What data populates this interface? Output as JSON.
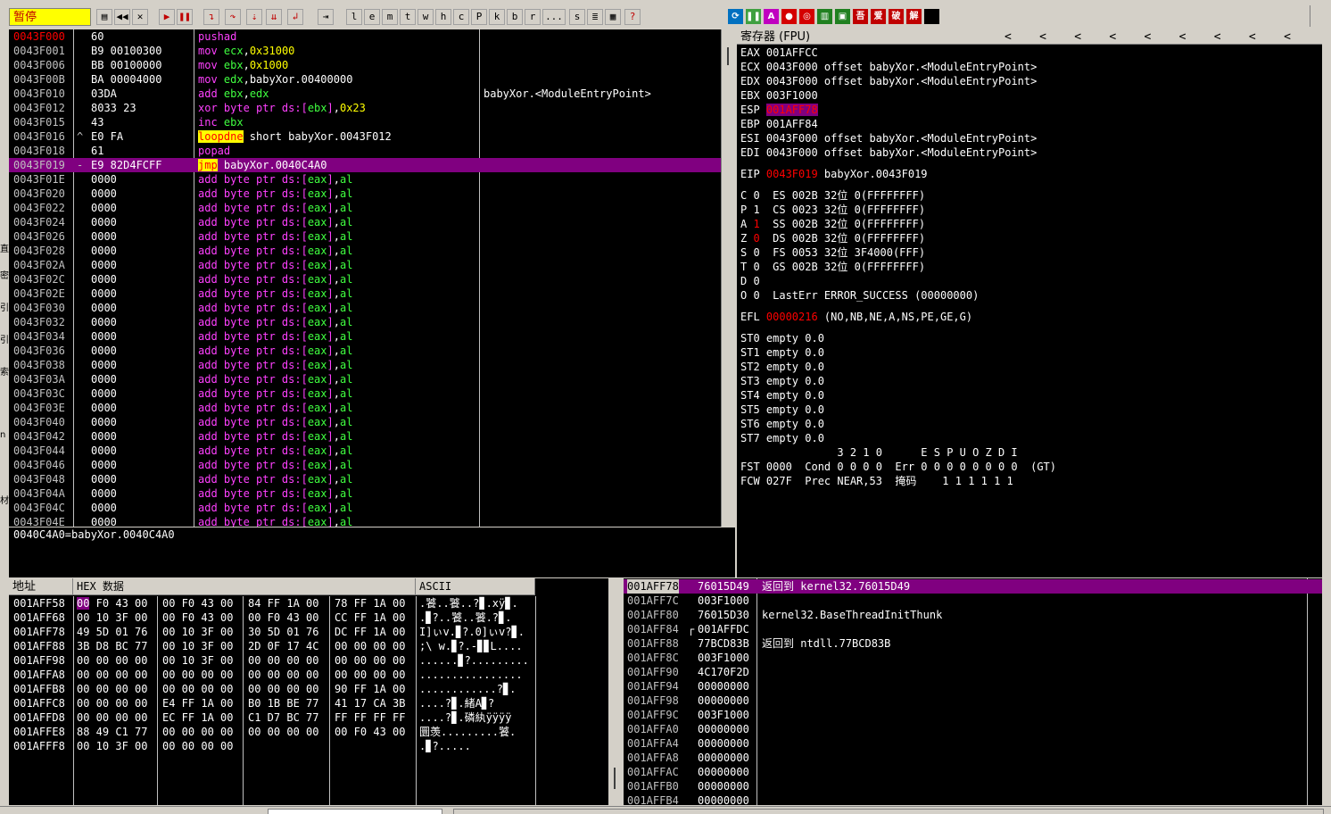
{
  "toolbar": {
    "state": "暂停",
    "letters": [
      "l",
      "e",
      "m",
      "t",
      "w",
      "h",
      "c",
      "P",
      "k",
      "b",
      "r",
      "...",
      "s"
    ],
    "right_icons": [
      "A",
      "吾",
      "爱",
      "破",
      "解"
    ]
  },
  "disasm": {
    "rows": [
      {
        "addr": "0043F000",
        "mark": "",
        "hex": "60",
        "asm": [
          [
            "kw",
            "pushad"
          ]
        ],
        "cmt": "",
        "addr_red": true
      },
      {
        "addr": "0043F001",
        "mark": "",
        "hex": "B9 00100300",
        "asm": [
          [
            "kw",
            "mov "
          ],
          [
            "reg",
            "ecx"
          ],
          [
            "",
            ","
          ],
          [
            "imm",
            "0x31000"
          ]
        ],
        "cmt": ""
      },
      {
        "addr": "0043F006",
        "mark": "",
        "hex": "BB 00100000",
        "asm": [
          [
            "kw",
            "mov "
          ],
          [
            "reg",
            "ebx"
          ],
          [
            "",
            ","
          ],
          [
            "imm",
            "0x1000"
          ]
        ],
        "cmt": ""
      },
      {
        "addr": "0043F00B",
        "mark": "",
        "hex": "BA 00004000",
        "asm": [
          [
            "kw",
            "mov "
          ],
          [
            "reg",
            "edx"
          ],
          [
            "",
            ",babyXor.00400000"
          ]
        ],
        "cmt": ""
      },
      {
        "addr": "0043F010",
        "mark": "",
        "hex": "03DA",
        "asm": [
          [
            "kw",
            "add "
          ],
          [
            "reg",
            "ebx"
          ],
          [
            "",
            ","
          ],
          [
            "reg",
            "edx"
          ]
        ],
        "cmt": "babyXor.<ModuleEntryPoint>"
      },
      {
        "addr": "0043F012",
        "mark": "",
        "hex": "8033 23",
        "asm": [
          [
            "kw",
            "xor byte ptr "
          ],
          [
            "kw",
            "ds:["
          ],
          [
            "reg",
            "ebx"
          ],
          [
            "kw",
            "]"
          ],
          [
            "",
            ","
          ],
          [
            "imm",
            "0x23"
          ]
        ],
        "cmt": ""
      },
      {
        "addr": "0043F015",
        "mark": "",
        "hex": "43",
        "asm": [
          [
            "kw",
            "inc "
          ],
          [
            "reg",
            "ebx"
          ]
        ],
        "cmt": ""
      },
      {
        "addr": "0043F016",
        "mark": "^",
        "hex": "E0 FA",
        "asm": [
          [
            "hl",
            "loopdne"
          ],
          [
            "",
            " short babyXor.0043F012"
          ]
        ],
        "cmt": ""
      },
      {
        "addr": "0043F018",
        "mark": "",
        "hex": "61",
        "asm": [
          [
            "kw",
            "popad"
          ]
        ],
        "cmt": ""
      },
      {
        "addr": "0043F019",
        "mark": "-",
        "hex": "E9 82D4FCFF",
        "asm": [
          [
            "hl",
            "jmp"
          ],
          [
            "",
            " babyXor.0040C4A0"
          ]
        ],
        "cmt": "",
        "sel": true
      },
      {
        "addr": "0043F01E",
        "mark": "",
        "hex": "0000",
        "asm": "add",
        "cmt": ""
      },
      {
        "addr": "0043F020",
        "mark": "",
        "hex": "0000",
        "asm": "add",
        "cmt": ""
      },
      {
        "addr": "0043F022",
        "mark": "",
        "hex": "0000",
        "asm": "add",
        "cmt": ""
      },
      {
        "addr": "0043F024",
        "mark": "",
        "hex": "0000",
        "asm": "add",
        "cmt": ""
      },
      {
        "addr": "0043F026",
        "mark": "",
        "hex": "0000",
        "asm": "add",
        "cmt": ""
      },
      {
        "addr": "0043F028",
        "mark": "",
        "hex": "0000",
        "asm": "add",
        "cmt": ""
      },
      {
        "addr": "0043F02A",
        "mark": "",
        "hex": "0000",
        "asm": "add",
        "cmt": ""
      },
      {
        "addr": "0043F02C",
        "mark": "",
        "hex": "0000",
        "asm": "add",
        "cmt": ""
      },
      {
        "addr": "0043F02E",
        "mark": "",
        "hex": "0000",
        "asm": "add",
        "cmt": ""
      },
      {
        "addr": "0043F030",
        "mark": "",
        "hex": "0000",
        "asm": "add",
        "cmt": ""
      },
      {
        "addr": "0043F032",
        "mark": "",
        "hex": "0000",
        "asm": "add",
        "cmt": ""
      },
      {
        "addr": "0043F034",
        "mark": "",
        "hex": "0000",
        "asm": "add",
        "cmt": ""
      },
      {
        "addr": "0043F036",
        "mark": "",
        "hex": "0000",
        "asm": "add",
        "cmt": ""
      },
      {
        "addr": "0043F038",
        "mark": "",
        "hex": "0000",
        "asm": "add",
        "cmt": ""
      },
      {
        "addr": "0043F03A",
        "mark": "",
        "hex": "0000",
        "asm": "add",
        "cmt": ""
      },
      {
        "addr": "0043F03C",
        "mark": "",
        "hex": "0000",
        "asm": "add",
        "cmt": ""
      },
      {
        "addr": "0043F03E",
        "mark": "",
        "hex": "0000",
        "asm": "add",
        "cmt": ""
      },
      {
        "addr": "0043F040",
        "mark": "",
        "hex": "0000",
        "asm": "add",
        "cmt": ""
      },
      {
        "addr": "0043F042",
        "mark": "",
        "hex": "0000",
        "asm": "add",
        "cmt": ""
      },
      {
        "addr": "0043F044",
        "mark": "",
        "hex": "0000",
        "asm": "add",
        "cmt": ""
      },
      {
        "addr": "0043F046",
        "mark": "",
        "hex": "0000",
        "asm": "add",
        "cmt": ""
      },
      {
        "addr": "0043F048",
        "mark": "",
        "hex": "0000",
        "asm": "add",
        "cmt": ""
      },
      {
        "addr": "0043F04A",
        "mark": "",
        "hex": "0000",
        "asm": "add",
        "cmt": ""
      },
      {
        "addr": "0043F04C",
        "mark": "",
        "hex": "0000",
        "asm": "add",
        "cmt": ""
      },
      {
        "addr": "0043F04E",
        "mark": "",
        "hex": "0000",
        "asm": "add",
        "cmt": ""
      }
    ],
    "add_parts": [
      [
        "kw",
        "add byte ptr ds:["
      ],
      [
        "reg",
        "eax"
      ],
      [
        "kw",
        "]"
      ],
      [
        "",
        ","
      ],
      [
        "reg",
        "al"
      ]
    ]
  },
  "info_line": "0040C4A0=babyXor.0040C4A0",
  "registers": {
    "title": "寄存器 (FPU)",
    "nav_arrows": [
      "<",
      "<",
      "<",
      "<",
      "<",
      "<",
      "<",
      "<",
      "<"
    ],
    "gp": [
      {
        "name": "EAX",
        "val": "001AFFCC",
        "cmt": ""
      },
      {
        "name": "ECX",
        "val": "0043F000",
        "cmt": "offset babyXor.<ModuleEntryPoint>"
      },
      {
        "name": "EDX",
        "val": "0043F000",
        "cmt": "offset babyXor.<ModuleEntryPoint>"
      },
      {
        "name": "EBX",
        "val": "003F1000",
        "cmt": ""
      },
      {
        "name": "ESP",
        "val": "001AFF78",
        "cmt": "",
        "hl": true
      },
      {
        "name": "EBP",
        "val": "001AFF84",
        "cmt": ""
      },
      {
        "name": "ESI",
        "val": "0043F000",
        "cmt": "offset babyXor.<ModuleEntryPoint>"
      },
      {
        "name": "EDI",
        "val": "0043F000",
        "cmt": "offset babyXor.<ModuleEntryPoint>"
      }
    ],
    "eip": {
      "name": "EIP",
      "val": "0043F019",
      "cmt": "babyXor.0043F019"
    },
    "flags": [
      {
        "f": "C",
        "v": "0",
        "seg": "ES 002B 32位 0(FFFFFFFF)"
      },
      {
        "f": "P",
        "v": "1",
        "seg": "CS 0023 32位 0(FFFFFFFF)"
      },
      {
        "f": "A",
        "v": "1",
        "seg": "SS 002B 32位 0(FFFFFFFF)",
        "red": true
      },
      {
        "f": "Z",
        "v": "0",
        "seg": "DS 002B 32位 0(FFFFFFFF)",
        "red": true
      },
      {
        "f": "S",
        "v": "0",
        "seg": "FS 0053 32位 3F4000(FFF)"
      },
      {
        "f": "T",
        "v": "0",
        "seg": "GS 002B 32位 0(FFFFFFFF)"
      },
      {
        "f": "D",
        "v": "0",
        "seg": ""
      },
      {
        "f": "O",
        "v": "0",
        "seg": "LastErr ERROR_SUCCESS (00000000)"
      }
    ],
    "efl": {
      "name": "EFL",
      "val": "00000216",
      "cmt": "(NO,NB,NE,A,NS,PE,GE,G)"
    },
    "st": [
      "ST0 empty 0.0",
      "ST1 empty 0.0",
      "ST2 empty 0.0",
      "ST3 empty 0.0",
      "ST4 empty 0.0",
      "ST5 empty 0.0",
      "ST6 empty 0.0",
      "ST7 empty 0.0"
    ],
    "fpu_hdr": "               3 2 1 0      E S P U O Z D I",
    "fst": "FST 0000  Cond 0 0 0 0  Err 0 0 0 0 0 0 0 0  (GT)",
    "fcw": "FCW 027F  Prec NEAR,53  掩码    1 1 1 1 1 1"
  },
  "dump": {
    "hdr_addr": "地址",
    "hdr_hex": "HEX 数据",
    "hdr_ascii": "ASCII",
    "rows": [
      {
        "addr": "001AFF58",
        "h1": "00 F0 43 00",
        "h2": "00 F0 43 00",
        "h3": "84 FF 1A 00",
        "h4": "78 FF 1A 00",
        "ascii": ".饕..饕..?▊.xÿ▊."
      },
      {
        "addr": "001AFF68",
        "h1": "00 10 3F 00",
        "h2": "00 F0 43 00",
        "h3": "00 F0 43 00",
        "h4": "CC FF 1A 00",
        "ascii": ".▊?..饕..饕.?▊."
      },
      {
        "addr": "001AFF78",
        "h1": "49 5D 01 76",
        "h2": "00 10 3F 00",
        "h3": "30 5D 01 76",
        "h4": "DC FF 1A 00",
        "ascii": "I]ぃv.▊?.0]ぃv?▊."
      },
      {
        "addr": "001AFF88",
        "h1": "3B D8 BC 77",
        "h2": "00 10 3F 00",
        "h3": "2D 0F 17 4C",
        "h4": "00 00 00 00",
        "ascii": ";\\ w.▊?.-▊▊L...."
      },
      {
        "addr": "001AFF98",
        "h1": "00 00 00 00",
        "h2": "00 10 3F 00",
        "h3": "00 00 00 00",
        "h4": "00 00 00 00",
        "ascii": "......▊?........."
      },
      {
        "addr": "001AFFA8",
        "h1": "00 00 00 00",
        "h2": "00 00 00 00",
        "h3": "00 00 00 00",
        "h4": "00 00 00 00",
        "ascii": "................"
      },
      {
        "addr": "001AFFB8",
        "h1": "00 00 00 00",
        "h2": "00 00 00 00",
        "h3": "00 00 00 00",
        "h4": "90 FF 1A 00",
        "ascii": "............?▊."
      },
      {
        "addr": "001AFFC8",
        "h1": "00 00 00 00",
        "h2": "E4 FF 1A 00",
        "h3": "B0 1B BE 77",
        "h4": "41 17 CA 3B",
        "ascii": "....?▊.緒A▊?"
      },
      {
        "addr": "001AFFD8",
        "h1": "00 00 00 00",
        "h2": "EC FF 1A 00",
        "h3": "C1 D7 BC 77",
        "h4": "FF FF FF FF",
        "ascii": "....?▊.磷紈ÿÿÿÿ"
      },
      {
        "addr": "001AFFE8",
        "h1": "88 49 C1 77",
        "h2": "00 00 00 00",
        "h3": "00 00 00 00",
        "h4": "00 F0 43 00",
        "ascii": "圜羡.........饕."
      },
      {
        "addr": "001AFFF8",
        "h1": "00 10 3F 00",
        "h2": "00 00 00 00",
        "h3": "",
        "h4": "",
        "ascii": ".▊?....."
      }
    ]
  },
  "stack": {
    "rows": [
      {
        "addr": "001AFF78",
        "val": "76015D49",
        "cmt": "返回到 kernel32.76015D49",
        "sel": true,
        "mark": ""
      },
      {
        "addr": "001AFF7C",
        "val": "003F1000",
        "cmt": "",
        "mark": ""
      },
      {
        "addr": "001AFF80",
        "val": "76015D30",
        "cmt": "kernel32.BaseThreadInitThunk",
        "mark": ""
      },
      {
        "addr": "001AFF84",
        "val": "001AFFDC",
        "cmt": "",
        "mark": "┌"
      },
      {
        "addr": "001AFF88",
        "val": "77BCD83B",
        "cmt": "返回到 ntdll.77BCD83B",
        "mark": ""
      },
      {
        "addr": "001AFF8C",
        "val": "003F1000",
        "cmt": "",
        "mark": ""
      },
      {
        "addr": "001AFF90",
        "val": "4C170F2D",
        "cmt": "",
        "mark": ""
      },
      {
        "addr": "001AFF94",
        "val": "00000000",
        "cmt": "",
        "mark": ""
      },
      {
        "addr": "001AFF98",
        "val": "00000000",
        "cmt": "",
        "mark": ""
      },
      {
        "addr": "001AFF9C",
        "val": "003F1000",
        "cmt": "",
        "mark": ""
      },
      {
        "addr": "001AFFA0",
        "val": "00000000",
        "cmt": "",
        "mark": ""
      },
      {
        "addr": "001AFFA4",
        "val": "00000000",
        "cmt": "",
        "mark": ""
      },
      {
        "addr": "001AFFA8",
        "val": "00000000",
        "cmt": "",
        "mark": ""
      },
      {
        "addr": "001AFFAC",
        "val": "00000000",
        "cmt": "",
        "mark": ""
      },
      {
        "addr": "001AFFB0",
        "val": "00000000",
        "cmt": "",
        "mark": ""
      },
      {
        "addr": "001AFFB4",
        "val": "00000000",
        "cmt": "",
        "mark": ""
      }
    ]
  }
}
